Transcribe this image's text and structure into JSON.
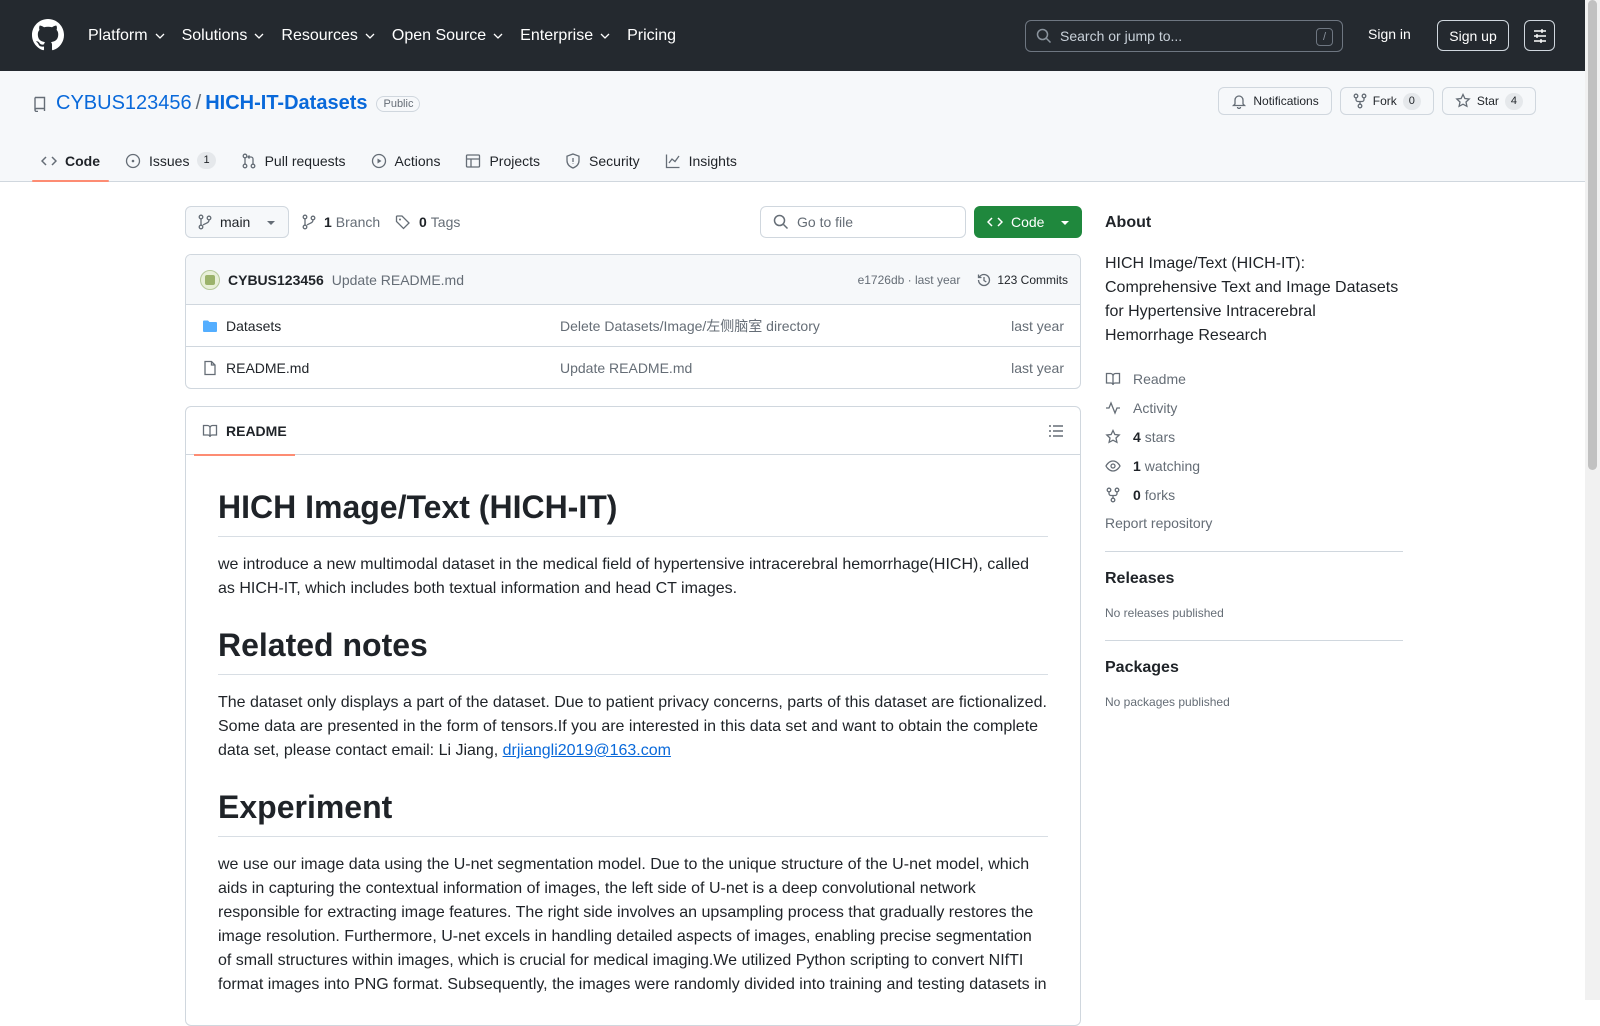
{
  "topnav": {
    "items": [
      {
        "label": "Platform",
        "dropdown": true
      },
      {
        "label": "Solutions",
        "dropdown": true
      },
      {
        "label": "Resources",
        "dropdown": true
      },
      {
        "label": "Open Source",
        "dropdown": true
      },
      {
        "label": "Enterprise",
        "dropdown": true
      },
      {
        "label": "Pricing",
        "dropdown": false
      }
    ],
    "search_placeholder": "Search or jump to...",
    "search_shortcut": "/",
    "signin": "Sign in",
    "signup": "Sign up"
  },
  "repo": {
    "owner": "CYBUS123456",
    "separator": "/",
    "name": "HICH-IT-Datasets",
    "visibility": "Public",
    "notifications_label": "Notifications",
    "fork_label": "Fork",
    "fork_count": "0",
    "star_label": "Star",
    "star_count": "4"
  },
  "tabs": [
    {
      "label": "Code",
      "icon": "code-icon",
      "active": true,
      "count": ""
    },
    {
      "label": "Issues",
      "icon": "issue-icon",
      "active": false,
      "count": "1"
    },
    {
      "label": "Pull requests",
      "icon": "pull-request-icon",
      "active": false,
      "count": ""
    },
    {
      "label": "Actions",
      "icon": "play-icon",
      "active": false,
      "count": ""
    },
    {
      "label": "Projects",
      "icon": "table-icon",
      "active": false,
      "count": ""
    },
    {
      "label": "Security",
      "icon": "shield-icon",
      "active": false,
      "count": ""
    },
    {
      "label": "Insights",
      "icon": "graph-icon",
      "active": false,
      "count": ""
    }
  ],
  "branchbar": {
    "branch": "main",
    "branch_count": "1",
    "branch_label": "Branch",
    "tag_count": "0",
    "tag_label": "Tags",
    "goto_placeholder": "Go to file",
    "code_button": "Code"
  },
  "commit": {
    "author": "CYBUS123456",
    "message": "Update README.md",
    "hash_time": "e1726db · last year",
    "commits_label": "123 Commits"
  },
  "files": [
    {
      "type": "folder",
      "name": "Datasets",
      "message": "Delete Datasets/Image/左侧脑室 directory",
      "date": "last year"
    },
    {
      "type": "file",
      "name": "README.md",
      "message": "Update README.md",
      "date": "last year"
    }
  ],
  "readme": {
    "tab_label": "README",
    "h1": "HICH Image/Text (HICH-IT)",
    "p1": "we introduce a new multimodal dataset in the medical field of hypertensive intracerebral hemorrhage(HICH), called as HICH-IT, which includes both textual information and head CT images.",
    "h2": "Related notes",
    "p2_text": "The dataset only displays a part of the dataset. Due to patient privacy concerns, parts of this dataset are fictionalized. Some data are presented in the form of tensors.If you are interested in this data set and want to obtain the complete data set, please contact email: Li Jiang, ",
    "p2_email": "drjiangli2019@163.com",
    "h3": "Experiment",
    "p3": "we use our image data using the U-net segmentation model. Due to the unique structure of the U-net model, which aids in capturing the contextual information of images, the left side of U-net is a deep convolutional network responsible for extracting image features. The right side involves an upsampling process that gradually restores the image resolution. Furthermore, U-net excels in handling detailed aspects of images, enabling precise segmentation of small structures within images, which is crucial for medical imaging.We utilized Python scripting to convert NIfTI format images into PNG format. Subsequently, the images were randomly divided into training and testing datasets in"
  },
  "about": {
    "title": "About",
    "description": "HICH Image/Text (HICH-IT): Comprehensive Text and Image Datasets for Hypertensive Intracerebral Hemorrhage Research",
    "readme": "Readme",
    "activity": "Activity",
    "stars_count": "4",
    "stars_label": "stars",
    "watching_count": "1",
    "watching_label": "watching",
    "forks_count": "0",
    "forks_label": "forks",
    "report": "Report repository",
    "releases_title": "Releases",
    "releases_text": "No releases published",
    "packages_title": "Packages",
    "packages_text": "No packages published"
  },
  "colors": {
    "header_bg": "#24292f",
    "link": "#0969da",
    "primary_button": "#1f883d",
    "active_tab_underline": "#fd8c73"
  }
}
